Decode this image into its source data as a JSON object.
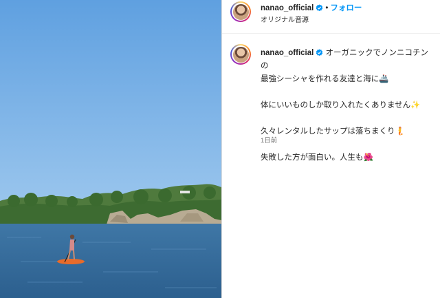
{
  "post": {
    "username": "nanao_official",
    "follow_label": "フォロー",
    "audio_label": "オリジナル音源",
    "caption_line1": "オーガニックでノンニコチンの",
    "caption_line2": "最強シーシャを作れる友達と海に🚢",
    "caption_line3": "体にいいものしか取り入れたくありません✨",
    "caption_line4": "久々レンタルしたサップは落ちまくり🧜",
    "caption_line5": "失敗した方が面白い。人生も🌺",
    "timestamp": "1日前"
  },
  "icons": [
    "verified-badge-icon",
    "avatar"
  ],
  "colors": {
    "accent": "#0095f6",
    "verified": "#0095f6"
  }
}
